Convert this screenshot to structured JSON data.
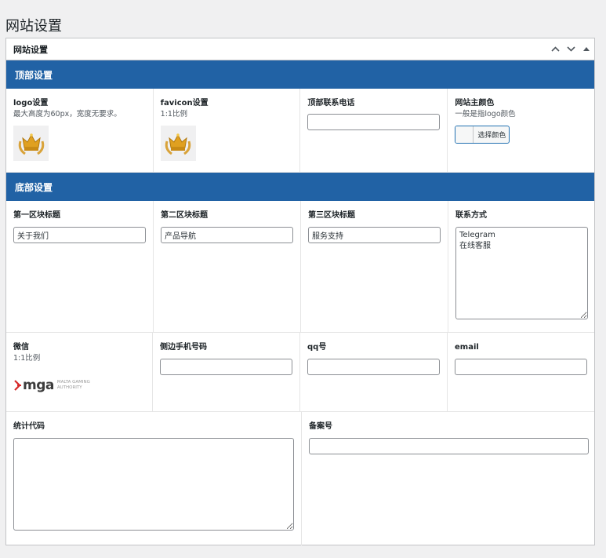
{
  "page": {
    "title": "网站设置"
  },
  "box": {
    "title": "网站设置",
    "actions": {
      "up": "∧",
      "down": "∨",
      "toggle": "▲"
    }
  },
  "header_section": {
    "title": "顶部设置",
    "logo": {
      "label": "logo设置",
      "desc": "最大高度为60px，宽度无要求。"
    },
    "favicon": {
      "label": "favicon设置",
      "desc": "1:1比例"
    },
    "phone": {
      "label": "顶部联系电话",
      "value": ""
    },
    "color": {
      "label": "网站主颜色",
      "desc": "一般是指logo颜色",
      "button": "选择颜色"
    }
  },
  "footer_section": {
    "title": "底部设置",
    "block1": {
      "label": "第一区块标题",
      "value": "关于我们"
    },
    "block2": {
      "label": "第二区块标题",
      "value": "产品导航"
    },
    "block3": {
      "label": "第三区块标题",
      "value": "服务支持"
    },
    "contact": {
      "label": "联系方式",
      "value": "Telegram\n在线客服"
    },
    "wechat": {
      "label": "微信",
      "desc": "1:1比例",
      "logo_text": "mga",
      "logo_sub1": "MALTA GAMING",
      "logo_sub2": "AUTHORITY"
    },
    "side_phone": {
      "label": "侧边手机号码",
      "value": ""
    },
    "qq": {
      "label": "qq号",
      "value": ""
    },
    "email": {
      "label": "email",
      "value": ""
    },
    "stats": {
      "label": "统计代码",
      "value": ""
    },
    "icp": {
      "label": "备案号",
      "value": ""
    }
  },
  "colors": {
    "section_bar": "#2162a5",
    "accent": "#2271b1",
    "crown_gold": "#e0a020"
  }
}
